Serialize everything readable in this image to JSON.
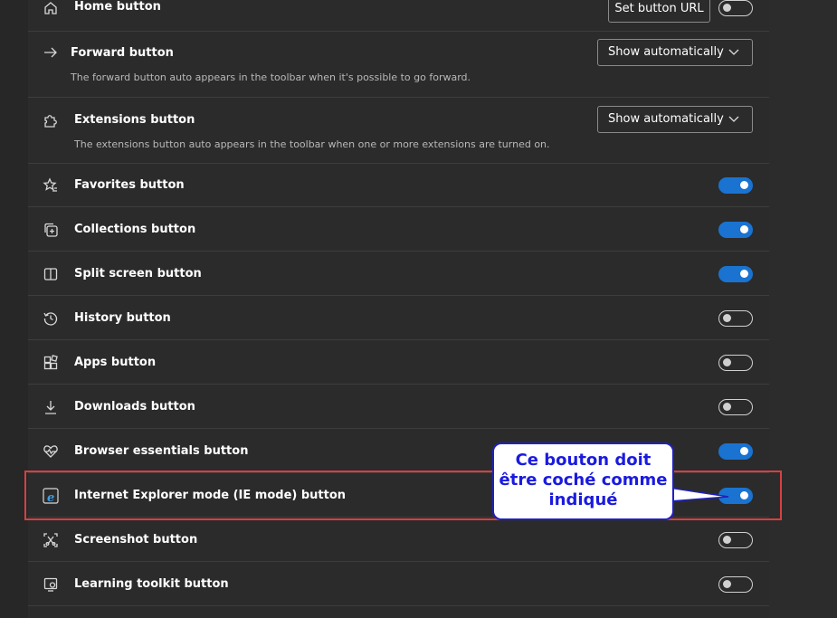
{
  "settings": {
    "home": {
      "label": "Home button",
      "action_label": "Set button URL",
      "enabled": false
    },
    "forward": {
      "label": "Forward button",
      "description": "The forward button auto appears in the toolbar when it's possible to go forward.",
      "select_value": "Show automatically"
    },
    "extensions": {
      "label": "Extensions button",
      "description": "The extensions button auto appears in the toolbar when one or more extensions are turned on.",
      "select_value": "Show automatically"
    },
    "favorites": {
      "label": "Favorites button",
      "enabled": true
    },
    "collections": {
      "label": "Collections button",
      "enabled": true
    },
    "split_screen": {
      "label": "Split screen button",
      "enabled": true
    },
    "history": {
      "label": "History button",
      "enabled": false
    },
    "apps": {
      "label": "Apps button",
      "enabled": false
    },
    "downloads": {
      "label": "Downloads button",
      "enabled": false
    },
    "browser_essentials": {
      "label": "Browser essentials button",
      "enabled": true
    },
    "ie_mode": {
      "label": "Internet Explorer mode (IE mode) button",
      "enabled": true
    },
    "screenshot": {
      "label": "Screenshot button",
      "enabled": false
    },
    "learning_toolkit": {
      "label": "Learning toolkit button",
      "enabled": false
    }
  },
  "annotation": {
    "callout_text": "Ce bouton doit être coché comme indiqué",
    "highlight_color": "#d84040",
    "callout_border_color": "#2020c0",
    "callout_text_color": "#1a1ae0"
  },
  "colors": {
    "toggle_on": "#1a73d0",
    "panel": "#2b2b2b"
  }
}
